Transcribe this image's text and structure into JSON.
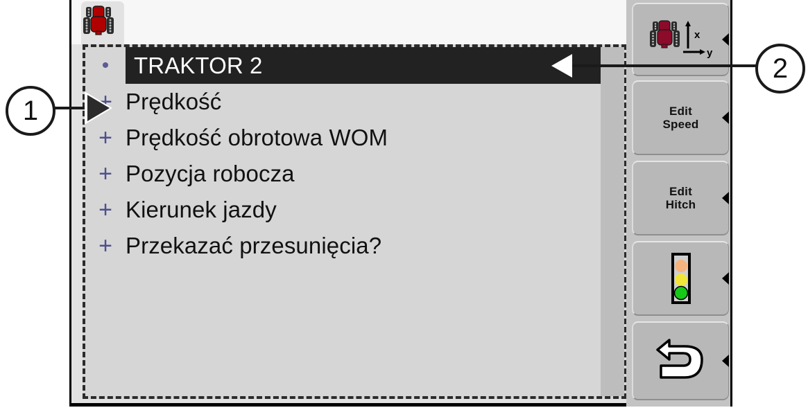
{
  "screen": {
    "tab": {
      "icon": "tractor-icon",
      "title": ""
    },
    "list": {
      "items": [
        {
          "marker": "•",
          "label": "TRAKTOR 2",
          "selected": true
        },
        {
          "marker": "+",
          "label": "Prędkość",
          "selected": false
        },
        {
          "marker": "+",
          "label": "Prędkość obrotowa WOM",
          "selected": false
        },
        {
          "marker": "+",
          "label": "Pozycja robocza",
          "selected": false
        },
        {
          "marker": "+",
          "label": "Kierunek jazdy",
          "selected": false
        },
        {
          "marker": "+",
          "label": "Przekazać przesunięcia?",
          "selected": false
        }
      ]
    },
    "softkeys": [
      {
        "name": "tractor-geometry-key",
        "icon": "tractor-xy-icon",
        "label": "",
        "axis_x": "x",
        "axis_y": "y"
      },
      {
        "name": "edit-speed-key",
        "icon": "",
        "label": "Edit\nSpeed",
        "line1": "Edit",
        "line2": "Speed"
      },
      {
        "name": "edit-hitch-key",
        "icon": "",
        "label": "Edit\nHitch",
        "line1": "Edit",
        "line2": "Hitch"
      },
      {
        "name": "status-traffic-light-key",
        "icon": "traffic-light-icon",
        "label": ""
      },
      {
        "name": "back-key",
        "icon": "back-arrow-icon",
        "label": ""
      }
    ]
  },
  "callouts": [
    {
      "id": "1",
      "number": "1"
    },
    {
      "id": "2",
      "number": "2"
    }
  ],
  "colors": {
    "selection_background": "#222222",
    "selection_text": "#ffffff",
    "marker_plus": "#4f4f8c",
    "screen_background": "#e2e2e2",
    "list_background": "#d6d6d6",
    "scrollbar_track": "#bdbdbd",
    "sidebar_background": "#c3c3c3",
    "softkey_face": "#b8b8b8",
    "tractor_red": "#b00000",
    "tractor_dark_red": "#8c0a2a",
    "traffic_red": "#f5b47e",
    "traffic_yellow": "#f2e53a",
    "traffic_green": "#16c916",
    "outline": "#1a1a1a"
  }
}
